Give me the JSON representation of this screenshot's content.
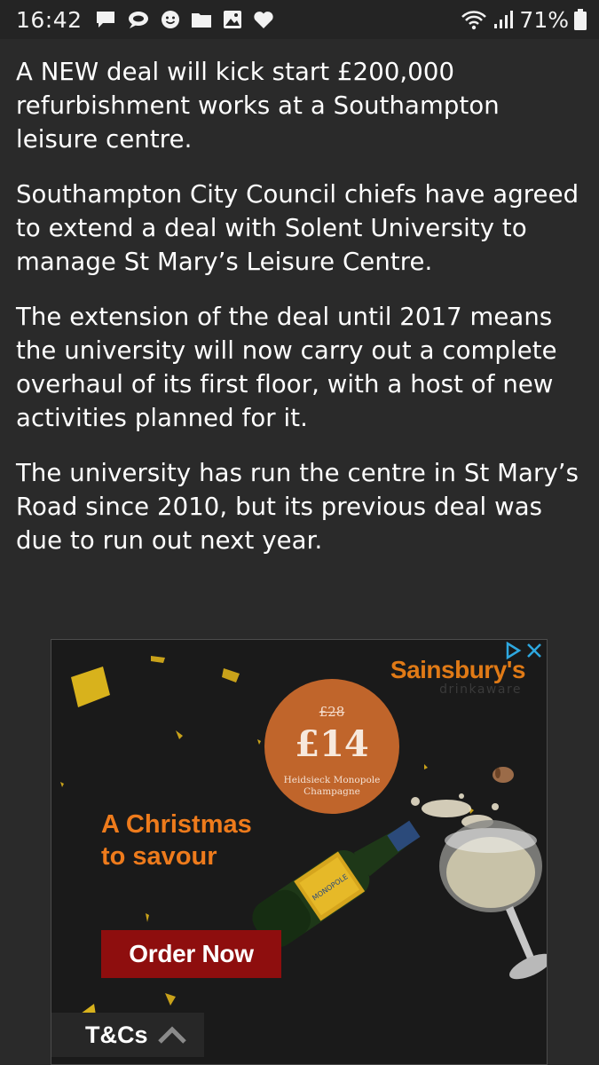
{
  "status_bar": {
    "time": "16:42",
    "battery_percent": "71%",
    "left_icons": [
      "message-icon",
      "chat-bubble-icon",
      "smiley-icon",
      "folder-icon",
      "gallery-icon",
      "heart-icon"
    ],
    "right_icons": [
      "wifi-icon",
      "signal-icon",
      "battery-icon"
    ]
  },
  "article": {
    "paragraphs": [
      "A NEW deal will kick start £200,000 refurbishment works at a Southampton leisure centre.",
      "Southampton City Council chiefs have agreed to extend a deal with Solent University to manage St Mary’s Leisure Centre.",
      "The extension of the deal until 2017 means the university will now carry out a complete overhaul of its first floor, with a host of new activities planned for it.",
      "The university has run the centre in St Mary’s Road since 2010, but its previous deal was due to run out next year."
    ]
  },
  "ad": {
    "brand": "Sainsbury's",
    "brand_sub": "drinkaware",
    "old_price": "£28",
    "new_price": "£14",
    "product": "Heidsieck Monopole Champagne",
    "headline_line1": "A Christmas",
    "headline_line2": "to savour",
    "cta": "Order Now",
    "terms": "T&Cs",
    "bottle_label": "MONOPOLE",
    "colors": {
      "brand_orange": "#e07a16",
      "badge": "#c0652b",
      "cta_bg": "#8e0e0e",
      "ad_choices_blue": "#2ea8e0"
    }
  },
  "colors": {
    "page_bg": "#2a2a2a",
    "status_bar_bg": "#242424",
    "text": "#ffffff"
  }
}
